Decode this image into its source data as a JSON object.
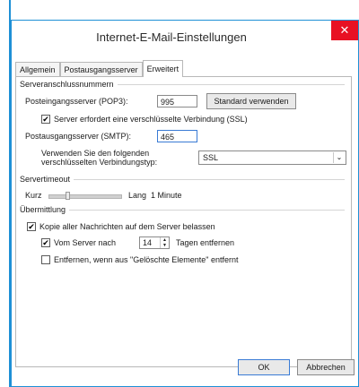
{
  "window": {
    "title": "Internet-E-Mail-Einstellungen",
    "close_glyph": "✕"
  },
  "tabs": [
    {
      "label": "Allgemein",
      "active": false
    },
    {
      "label": "Postausgangsserver",
      "active": false
    },
    {
      "label": "Erweitert",
      "active": true
    }
  ],
  "server_ports": {
    "group_label": "Serveranschlussnummern",
    "incoming_label": "Posteingangsserver (POP3):",
    "incoming_value": "995",
    "default_button": "Standard verwenden",
    "ssl_checkbox_label": "Server erfordert eine verschlüsselte Verbindung (SSL)",
    "ssl_checked": true,
    "outgoing_label": "Postausgangsserver (SMTP):",
    "outgoing_value": "465",
    "encryption_label_line1": "Verwenden Sie den folgenden",
    "encryption_label_line2": "verschlüsselten Verbindungstyp:",
    "encryption_value": "SSL"
  },
  "timeout": {
    "group_label": "Servertimeout",
    "short_label": "Kurz",
    "long_label": "Lang",
    "value_text": "1 Minute"
  },
  "delivery": {
    "group_label": "Übermittlung",
    "keep_copy_label": "Kopie aller Nachrichten auf dem Server belassen",
    "keep_copy_checked": true,
    "remove_after_label": "Vom Server nach",
    "remove_after_checked": true,
    "remove_after_days": "14",
    "remove_after_suffix": "Tagen entfernen",
    "remove_deleted_label": "Entfernen, wenn aus \"Gelöschte Elemente\" entfernt",
    "remove_deleted_checked": false
  },
  "footer": {
    "ok_label": "OK",
    "cancel_label": "Abbrechen"
  },
  "glyphs": {
    "check": "✔",
    "dropdown_arrow": "⌄",
    "spin_up": "▲",
    "spin_down": "▼"
  },
  "colors": {
    "accent_border": "#1e90d6",
    "close_button": "#e81123"
  }
}
